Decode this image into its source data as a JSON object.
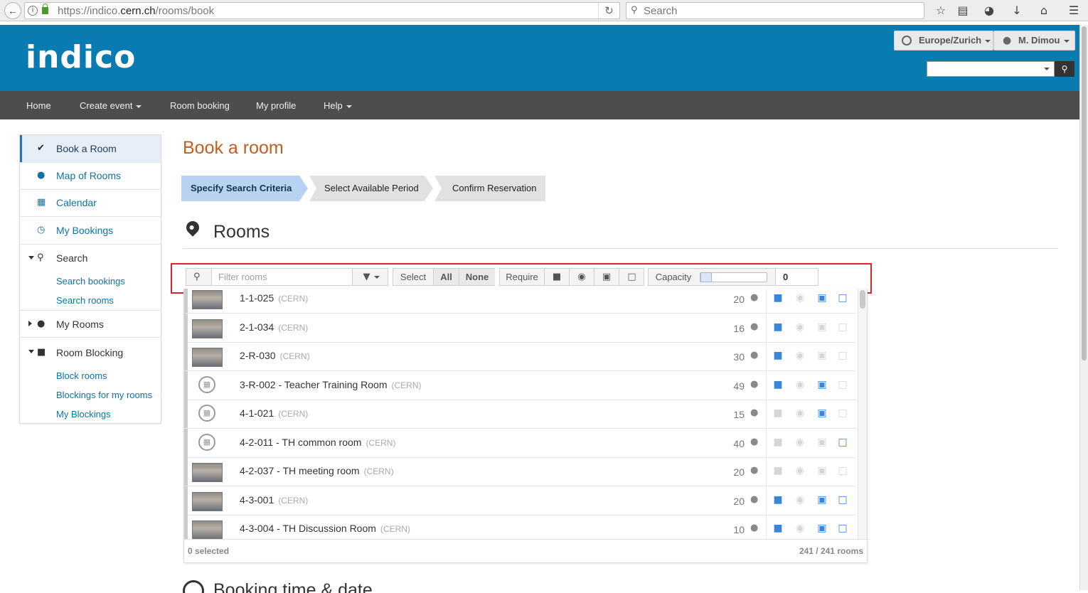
{
  "browser": {
    "url_prefix": "https://indico.",
    "url_domain": "cern.ch",
    "url_path": "/rooms/book",
    "search_placeholder": "Search",
    "icons": [
      "back-icon",
      "info-icon",
      "lock-icon",
      "reload-icon",
      "search-icon",
      "bookmark-star-icon",
      "reading-list-icon",
      "pocket-icon",
      "download-icon",
      "home-icon",
      "menu-icon"
    ]
  },
  "header": {
    "logo": "indico",
    "timezone": "Europe/Zurich",
    "user": "M. Dimou"
  },
  "nav": {
    "items": [
      {
        "label": "Home",
        "dropdown": false
      },
      {
        "label": "Create event",
        "dropdown": true
      },
      {
        "label": "Room booking",
        "dropdown": false
      },
      {
        "label": "My profile",
        "dropdown": false
      },
      {
        "label": "Help",
        "dropdown": true
      }
    ]
  },
  "sidebar": {
    "book_room": "Book a Room",
    "map_rooms": "Map of Rooms",
    "calendar": "Calendar",
    "my_bookings": "My Bookings",
    "search": "Search",
    "search_bookings": "Search bookings",
    "search_rooms": "Search rooms",
    "my_rooms": "My Rooms",
    "room_blocking": "Room Blocking",
    "block_rooms": "Block rooms",
    "blockings_for_my_rooms": "Blockings for my rooms",
    "my_blockings": "My Blockings"
  },
  "main": {
    "title": "Book a room",
    "steps": [
      "Specify Search Criteria",
      "Select Available Period",
      "Confirm Reservation"
    ],
    "active_step": 0,
    "rooms_title": "Rooms",
    "booking_title": "Booking time & date"
  },
  "filter": {
    "placeholder": "Filter rooms",
    "select_label": "Select",
    "all_label": "All",
    "none_label": "None",
    "require_label": "Require",
    "capacity_label": "Capacity",
    "capacity_value": "0"
  },
  "rooms": [
    {
      "name": "1-1-025",
      "site": "(CERN)",
      "capacity": "20",
      "photo": true,
      "video": true,
      "webcast": false,
      "projector": true,
      "unlocked": true
    },
    {
      "name": "2-1-034",
      "site": "(CERN)",
      "capacity": "16",
      "photo": true,
      "video": true,
      "webcast": false,
      "projector": false,
      "unlocked": false
    },
    {
      "name": "2-R-030",
      "site": "(CERN)",
      "capacity": "30",
      "photo": true,
      "video": true,
      "webcast": false,
      "projector": false,
      "unlocked": false
    },
    {
      "name": "3-R-002 - Teacher Training Room",
      "site": "(CERN)",
      "capacity": "49",
      "photo": false,
      "video": true,
      "webcast": false,
      "projector": true,
      "unlocked": false
    },
    {
      "name": "4-1-021",
      "site": "(CERN)",
      "capacity": "15",
      "photo": false,
      "video": false,
      "webcast": false,
      "projector": true,
      "unlocked": false
    },
    {
      "name": "4-2-011 - TH common room",
      "site": "(CERN)",
      "capacity": "40",
      "photo": false,
      "video": false,
      "webcast": false,
      "projector": false,
      "unlocked": true
    },
    {
      "name": "4-2-037 - TH meeting room",
      "site": "(CERN)",
      "capacity": "20",
      "photo": true,
      "video": false,
      "webcast": false,
      "projector": false,
      "unlocked": false
    },
    {
      "name": "4-3-001",
      "site": "(CERN)",
      "capacity": "20",
      "photo": true,
      "video": true,
      "webcast": false,
      "projector": true,
      "unlocked": true
    },
    {
      "name": "4-3-004 - TH Discussion Room",
      "site": "(CERN)",
      "capacity": "10",
      "photo": true,
      "video": true,
      "webcast": false,
      "projector": true,
      "unlocked": true
    }
  ],
  "list_footer": {
    "selected": "0 selected",
    "count": "241 / 241 rooms"
  },
  "colors": {
    "header_bg": "#0a7bb0",
    "nav_bg": "#4d4d4d",
    "title_orange": "#c35e1e",
    "link_blue": "#0d73a5",
    "facility_on": "#3a86d6",
    "highlight_red": "#d9262c"
  }
}
